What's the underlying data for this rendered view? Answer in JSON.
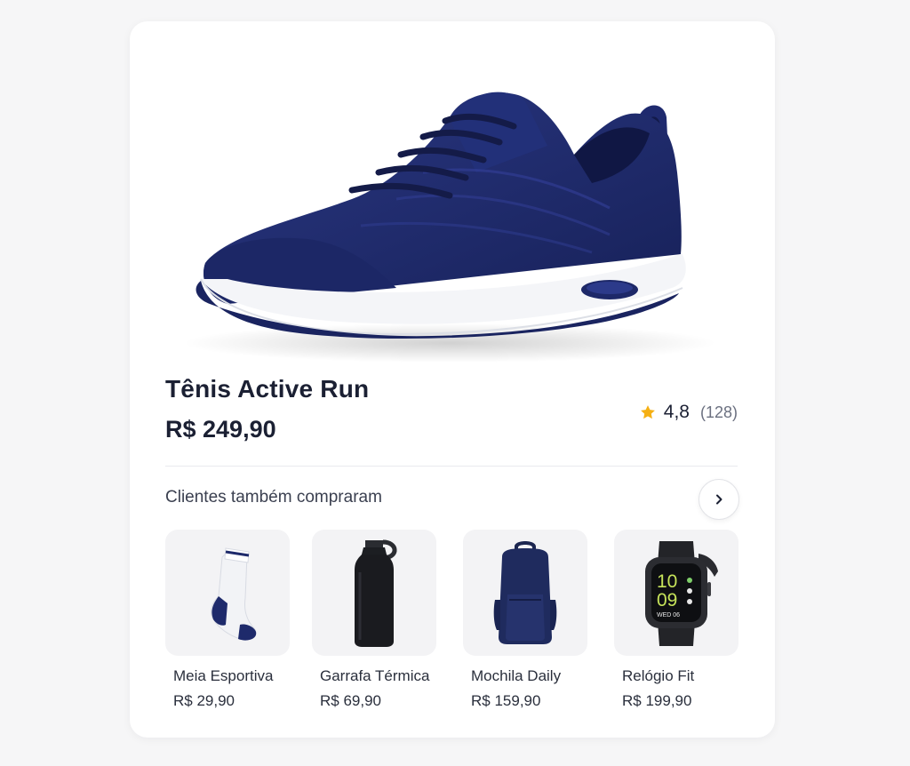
{
  "product": {
    "title": "Tênis Active Run",
    "price": "R$ 249,90",
    "rating": "4,8",
    "reviews": "(128)",
    "image_icon": "sneaker-image",
    "star_color": "#f5b014",
    "shoe_color": "#1e2a6b"
  },
  "related": {
    "heading": "Clientes também compraram",
    "next_icon": "chevron-right-icon",
    "items": [
      {
        "name": "Meia Esportiva",
        "price": "R$ 29,90",
        "icon": "sock-image"
      },
      {
        "name": "Garrafa Térmica",
        "price": "R$ 69,90",
        "icon": "bottle-image"
      },
      {
        "name": "Mochila Daily",
        "price": "R$ 159,90",
        "icon": "backpack-image"
      },
      {
        "name": "Relógio Fit",
        "price": "R$ 199,90",
        "icon": "smartwatch-image",
        "watch_time": [
          "10",
          "09"
        ],
        "watch_date": "WED 06"
      }
    ]
  }
}
